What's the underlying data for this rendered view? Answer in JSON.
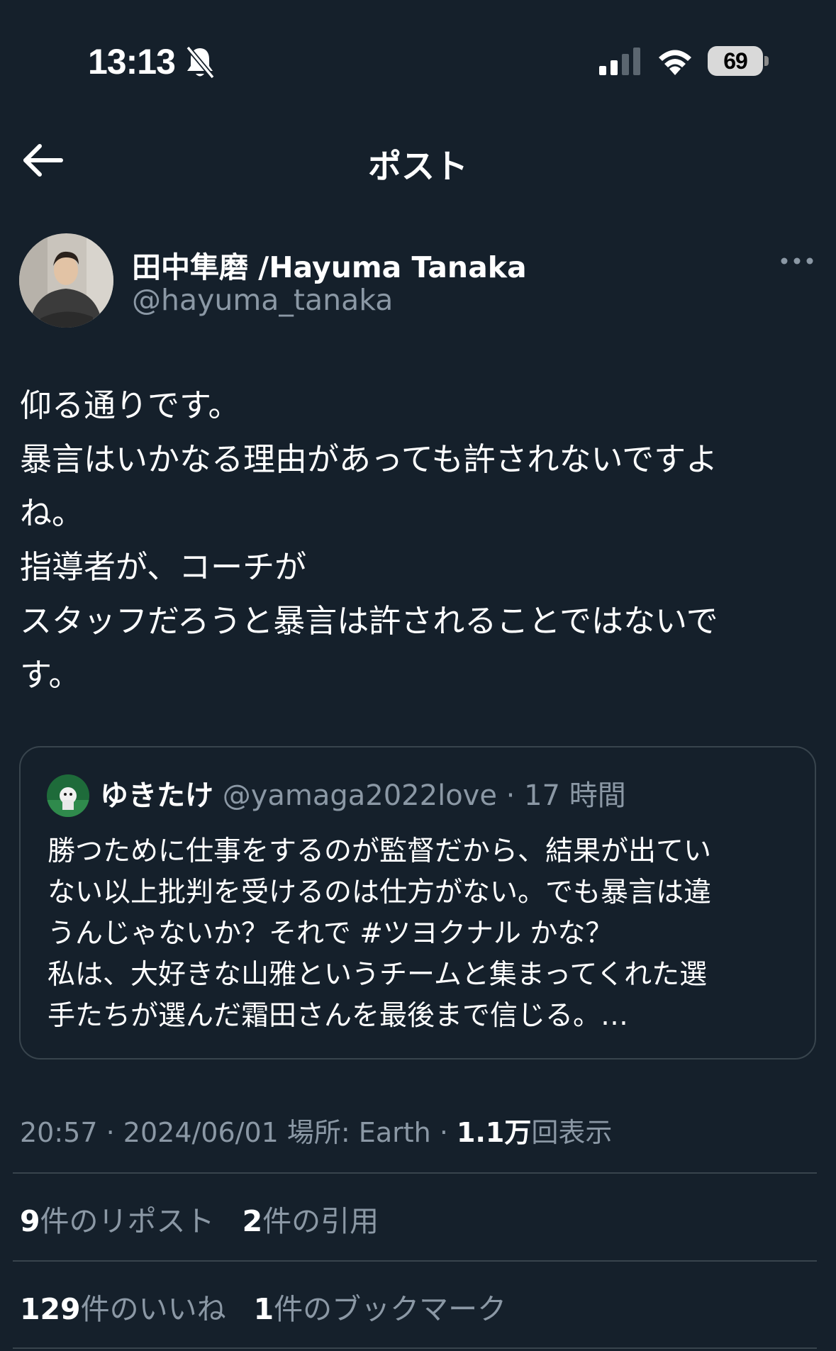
{
  "status_bar": {
    "time": "13:13",
    "battery": "69",
    "icons": [
      "bell-slash-icon",
      "cellular-signal-icon",
      "wifi-icon",
      "battery-icon"
    ]
  },
  "header": {
    "back_icon": "arrow-left-icon",
    "title": "ポスト"
  },
  "author": {
    "display_name": "田中隼磨 /Hayuma Tanaka",
    "handle": "@hayuma_tanaka",
    "more_icon": "more-horizontal-icon"
  },
  "post": {
    "lines": [
      "仰る通りです。",
      "暴言はいかなる理由があっても許されないですよ",
      "ね。",
      "指導者が、コーチが",
      "スタッフだろうと暴言は許されることではないで",
      "す。"
    ]
  },
  "quote": {
    "name": "ゆきたけ",
    "handle": "@yamaga2022love",
    "separator": "·",
    "time": "17 時間",
    "lines": [
      "勝つために仕事をするのが監督だから、結果が出てい",
      "ない以上批判を受けるのは仕方がない。でも暴言は違",
      "私は、大好きな山雅というチームと集まってくれた選",
      "手たちが選んだ霜田さんを最後まで信じる。…"
    ],
    "line3_before": "うんじゃないか？それで ",
    "line3_hashtag": "#ツヨクナル",
    "line3_after": " かな？"
  },
  "meta": {
    "time": "20:57",
    "sep": "·",
    "date": "2024/06/01",
    "location": "場所: Earth",
    "views_count": "1.1万",
    "views_label": "回表示"
  },
  "stats": {
    "reposts_count": "9",
    "reposts_label": "件のリポスト",
    "quotes_count": "2",
    "quotes_label": "件の引用",
    "likes_count": "129",
    "likes_label": "件のいいね",
    "bookmarks_count": "1",
    "bookmarks_label": "件のブックマーク"
  },
  "colors": {
    "background": "#15202b",
    "secondary_text": "#8b98a5",
    "border": "#38444d"
  }
}
